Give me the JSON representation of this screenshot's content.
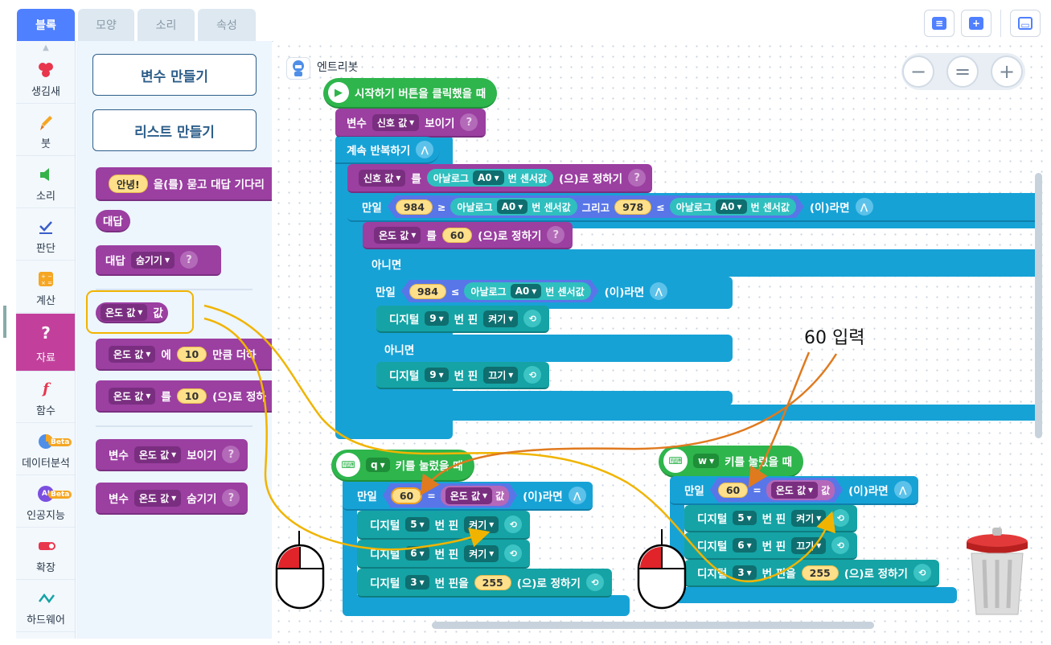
{
  "tabs": [
    "블록",
    "모양",
    "소리",
    "속성"
  ],
  "categories": [
    {
      "label": "생김새",
      "icon": "shapes-icon"
    },
    {
      "label": "붓",
      "icon": "brush-icon"
    },
    {
      "label": "소리",
      "icon": "speaker-icon"
    },
    {
      "label": "판단",
      "icon": "check-icon"
    },
    {
      "label": "계산",
      "icon": "calculator-icon"
    },
    {
      "label": "자료",
      "icon": "question-icon"
    },
    {
      "label": "함수",
      "icon": "function-icon"
    },
    {
      "label": "데이터분석",
      "icon": "pie-chart-icon",
      "badge": "Beta"
    },
    {
      "label": "인공지능",
      "icon": "ai-icon",
      "badge": "Beta",
      "ai": "AI"
    },
    {
      "label": "확장",
      "icon": "extension-icon"
    },
    {
      "label": "하드웨어",
      "icon": "hardware-icon"
    }
  ],
  "palette": {
    "make_variable": "변수 만들기",
    "make_list": "리스트 만들기",
    "ask_hello": "안녕!",
    "ask_text": "을(를) 묻고 대답 기다리",
    "answer": "대답",
    "answer_label": "대답",
    "hide": "숨기기",
    "var_name": "온도 값",
    "var_value_label": "값",
    "to_label": "에",
    "num_10": "10",
    "add_text": "만큼 더하",
    "set_label": "를",
    "set_text": "(으)로 정하",
    "variable_label": "변수",
    "show": "보이기",
    "hide2": "숨기기"
  },
  "object": {
    "name": "엔트리봇"
  },
  "main": {
    "hat_text": "시작하기 버튼을 클릭했을 때",
    "show_var_label": "변수",
    "signal_var": "신호 값",
    "show_text": "보이기",
    "forever": "계속 반복하기",
    "set_signal_pre": "를",
    "analog": "아날로그",
    "pin_a0": "A0",
    "sensor": "번 센서값",
    "set_post": "(으)로 정하기",
    "if_label": "만일",
    "num_984": "984",
    "ge": "≥",
    "and": "그리고",
    "num_978": "978",
    "le": "≤",
    "then": "(이)라면",
    "temp_var": "온도 값",
    "set_temp_pre": "를",
    "num_60": "60",
    "else_label": "아니면",
    "digital": "디지털",
    "pin_9": "9",
    "pin_label": "번 핀",
    "on": "켜기",
    "off": "끄기"
  },
  "qblock": {
    "key": "q",
    "hat_text": "키를 눌렀을 때",
    "if_label": "만일",
    "num_60": "60",
    "eq": "=",
    "var": "온도 값",
    "val": "값",
    "then": "(이)라면",
    "digital": "디지털",
    "pin_5": "5",
    "pin_6": "6",
    "pin_3": "3",
    "pin_label": "번 핀",
    "pin_label2": "번 핀을",
    "on": "켜기",
    "num_255": "255",
    "set_post": "(으)로 정하기"
  },
  "wblock": {
    "key": "w",
    "hat_text": "키를 눌렀을 때",
    "if_label": "만일",
    "num_60": "60",
    "eq": "=",
    "var": "온도 값",
    "val": "값",
    "then": "(이)라면",
    "digital": "디지털",
    "pin_5": "5",
    "pin_6": "6",
    "pin_3": "3",
    "pin_label": "번 핀",
    "pin_label2": "번 핀을",
    "on": "켜기",
    "off": "끄기",
    "num_255": "255",
    "set_post": "(으)로 정하기"
  },
  "annotation": {
    "text": "60 입력"
  },
  "colors": {
    "accent": "#4f80ff",
    "event": "#2eb54c",
    "data": "#9b3fa1",
    "flow": "#17a2d6",
    "hardware": "#15a3a5",
    "annotation_orange": "#e07a1f",
    "annotation_yellow": "#f0b400",
    "mouse_red": "#e0242a"
  }
}
